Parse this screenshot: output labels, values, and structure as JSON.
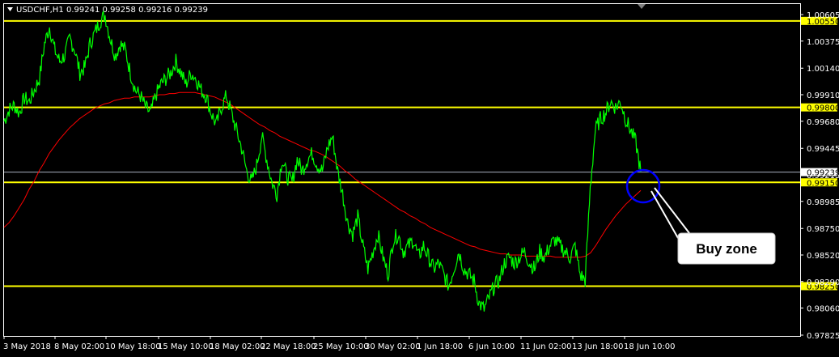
{
  "header": {
    "symbol": "USDCHF,H1",
    "ohlc": "0.99241 0.99258 0.99216 0.99239"
  },
  "colors": {
    "background": "#000000",
    "price": "#00ff00",
    "moving_average": "#ff0000",
    "levels": "#ffff00",
    "current_price_line": "#a9b0bf",
    "marker_circle": "#0000ff",
    "label_box": "#ffffff",
    "axis_text": "#ffffff"
  },
  "annotation": {
    "label": "Buy zone",
    "circle_icon": "circle-marker-icon"
  },
  "chart_data": {
    "type": "line",
    "title": "USDCHF,H1",
    "xlabel": "",
    "ylabel": "",
    "ylim": [
      0.97825,
      1.00605
    ],
    "grid": false,
    "y_ticks": [
      "1.00605",
      "1.00375",
      "1.00140",
      "0.99910",
      "0.99680",
      "0.99445",
      "0.99215",
      "0.98985",
      "0.98750",
      "0.98520",
      "0.98290",
      "0.98060",
      "0.97825"
    ],
    "x_ticks": [
      "3 May 2018",
      "8 May 02:00",
      "10 May 18:00",
      "15 May 10:00",
      "18 May 02:00",
      "22 May 18:00",
      "25 May 10:00",
      "30 May 02:00",
      "1 Jun 18:00",
      "6 Jun 10:00",
      "11 Jun 02:00",
      "13 Jun 18:00",
      "18 Jun 10:00"
    ],
    "levels": [
      {
        "label": "1.00550",
        "value": 1.0055
      },
      {
        "label": "0.99800",
        "value": 0.998
      },
      {
        "label": "0.99150",
        "value": 0.9915
      },
      {
        "label": "0.98250",
        "value": 0.9825
      }
    ],
    "current_price": {
      "label": "0.99239",
      "value": 0.99239
    },
    "series": [
      {
        "values": [
          0.9968,
          0.9978,
          0.9982,
          0.9975,
          0.9988,
          0.9985,
          0.9995,
          1.0005,
          1.0035,
          1.005,
          1.003,
          1.002,
          1.0025,
          1.004,
          1.003,
          1.001,
          1.0015,
          1.0035,
          1.0045,
          1.0055,
          1.006,
          1.004,
          1.0025,
          1.0035,
          1.003,
          1.001,
          0.9995,
          0.999,
          0.998,
          0.9975,
          0.999,
          1.0,
          1.0005,
          1.001,
          1.002,
          1.001,
          1.0,
          1.001,
          1.0005,
          0.9995,
          0.999,
          0.9975,
          0.9965,
          0.998,
          0.999,
          0.9975,
          0.996,
          0.9945,
          0.9925,
          0.9915,
          0.993,
          0.9955,
          0.9935,
          0.9915,
          0.9905,
          0.9935,
          0.992,
          0.9915,
          0.9935,
          0.9925,
          0.9935,
          0.994,
          0.993,
          0.9925,
          0.9945,
          0.9955,
          0.9925,
          0.9905,
          0.988,
          0.987,
          0.9885,
          0.986,
          0.984,
          0.9855,
          0.987,
          0.985,
          0.9835,
          0.9865,
          0.987,
          0.9855,
          0.986,
          0.9865,
          0.985,
          0.986,
          0.985,
          0.984,
          0.9845,
          0.9835,
          0.9825,
          0.984,
          0.9855,
          0.984,
          0.9835,
          0.983,
          0.981,
          0.9805,
          0.9815,
          0.9825,
          0.983,
          0.9845,
          0.985,
          0.9845,
          0.985,
          0.9855,
          0.9845,
          0.984,
          0.9855,
          0.985,
          0.986,
          0.9865,
          0.986,
          0.9855,
          0.985,
          0.986,
          0.9835,
          0.983,
          0.991,
          0.996,
          0.997,
          0.9975,
          0.9985,
          0.998,
          0.9985,
          0.997,
          0.996,
          0.995,
          0.9924
        ]
      },
      {
        "values": [
          0.9876,
          0.988,
          0.9886,
          0.9893,
          0.99,
          0.9909,
          0.9916,
          0.9925,
          0.9932,
          0.994,
          0.9946,
          0.9952,
          0.9957,
          0.9962,
          0.9966,
          0.997,
          0.9973,
          0.9976,
          0.9979,
          0.9981,
          0.9983,
          0.9984,
          0.9986,
          0.9987,
          0.9988,
          0.9988,
          0.9989,
          0.9989,
          0.9989,
          0.9989,
          0.999,
          0.9991,
          0.9991,
          0.9992,
          0.9992,
          0.9993,
          0.9993,
          0.9993,
          0.9993,
          0.9992,
          0.9991,
          0.999,
          0.9989,
          0.9987,
          0.9985,
          0.9983,
          0.998,
          0.9977,
          0.9974,
          0.9971,
          0.9968,
          0.9965,
          0.9963,
          0.996,
          0.9958,
          0.9955,
          0.9953,
          0.9951,
          0.9949,
          0.9947,
          0.9945,
          0.9943,
          0.9942,
          0.994,
          0.9938,
          0.9935,
          0.9932,
          0.9929,
          0.9925,
          0.9922,
          0.9918,
          0.9915,
          0.9912,
          0.9909,
          0.9906,
          0.9903,
          0.99,
          0.9897,
          0.9894,
          0.9891,
          0.9889,
          0.9886,
          0.9884,
          0.9881,
          0.9879,
          0.9876,
          0.9874,
          0.9872,
          0.987,
          0.9868,
          0.9866,
          0.9864,
          0.9862,
          0.986,
          0.9859,
          0.9857,
          0.9856,
          0.9855,
          0.9854,
          0.9853,
          0.9853,
          0.9852,
          0.9852,
          0.9852,
          0.9851,
          0.9851,
          0.9851,
          0.9851,
          0.9851,
          0.9851,
          0.985,
          0.985,
          0.985,
          0.985,
          0.985,
          0.985,
          0.9851,
          0.9854,
          0.986,
          0.9867,
          0.9874,
          0.988,
          0.9886,
          0.9891,
          0.9896,
          0.99,
          0.9904,
          0.9908
        ]
      }
    ]
  }
}
